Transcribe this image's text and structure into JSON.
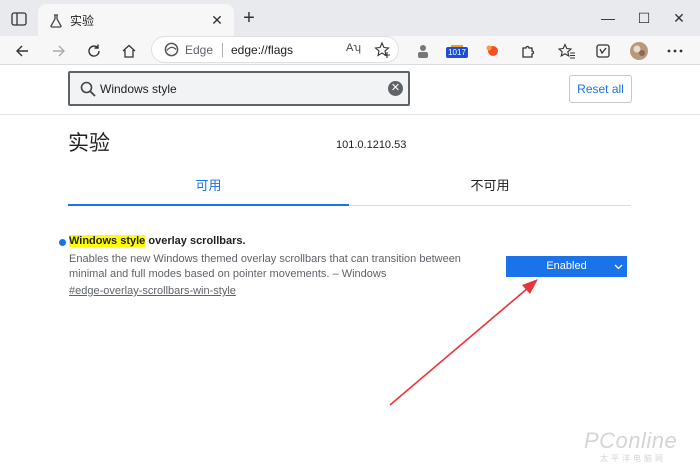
{
  "browser": {
    "tab_title": "实验",
    "new_tab_symbol": "+",
    "tab_close_symbol": "✕",
    "window": {
      "minimize": "—",
      "maximize": "☐",
      "close": "✕"
    }
  },
  "toolbar": {
    "edge_label": "Edge",
    "url": "edge://flags",
    "read_aloud": "Aʮ",
    "extension_badge": "1017",
    "icons": [
      "back-icon",
      "forward-icon",
      "refresh-icon",
      "home-icon",
      "read-aloud-icon",
      "favorite-add-icon",
      "extension-icon",
      "extension-badge-icon",
      "extension-orange-icon",
      "puzzle-icon",
      "favorites-icon",
      "collections-icon",
      "profile-avatar"
    ]
  },
  "flags": {
    "search_value": "Windows style",
    "reset_label": "Reset all",
    "title": "实验",
    "version": "101.0.1210.53",
    "tabs": {
      "available": "可用",
      "unavailable": "不可用"
    },
    "items": [
      {
        "name_highlight": "Windows style",
        "name_rest": " overlay scrollbars.",
        "description": "Enables the new Windows themed overlay scrollbars that can transition between minimal and full modes based on pointer movements. – Windows",
        "link": "#edge-overlay-scrollbars-win-style",
        "selected": "Enabled"
      }
    ]
  },
  "watermark": {
    "text": "PConline",
    "sub": "太平洋电脑网"
  },
  "colors": {
    "accent": "#1a73e8",
    "highlight": "#ffff00",
    "annotation_arrow": "#e8353b"
  }
}
